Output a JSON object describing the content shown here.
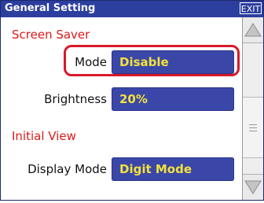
{
  "window": {
    "title": "General Setting",
    "exit_label": "EXIT"
  },
  "screen_saver": {
    "title": "Screen Saver",
    "mode": {
      "label": "Mode",
      "value": "Disable"
    },
    "brightness": {
      "label": "Brightness",
      "value": "20%"
    }
  },
  "initial_view": {
    "title": "Initial View",
    "display_mode": {
      "label": "Display Mode",
      "value": "Digit Mode"
    }
  },
  "colors": {
    "titlebar": "#2c3e9e",
    "section_title": "#e01919",
    "field_bg": "#3b47a8",
    "field_text": "#f2e23a",
    "highlight": "#d8192a"
  },
  "icons": {
    "scroll_up": "triangle-up-icon",
    "scroll_down": "triangle-down-icon",
    "scroll_grip": "grip-icon"
  }
}
